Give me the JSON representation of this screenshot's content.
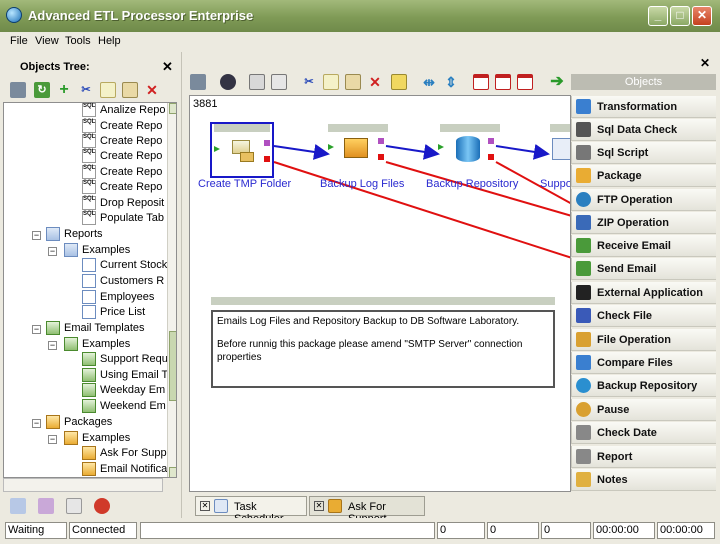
{
  "window": {
    "title": "Advanced ETL Processor Enterprise"
  },
  "menu": [
    "File",
    "View",
    "Tools",
    "Help"
  ],
  "objects_tree": {
    "title": "Objects Tree:",
    "nodes": [
      {
        "label": "Analize Repo",
        "icon": "sql-icon"
      },
      {
        "label": "Create Repo",
        "icon": "sql-icon"
      },
      {
        "label": "Create Repo",
        "icon": "sql-icon"
      },
      {
        "label": "Create Repo",
        "icon": "sql-icon"
      },
      {
        "label": "Create Repo",
        "icon": "sql-icon"
      },
      {
        "label": "Create Repo",
        "icon": "sql-icon"
      },
      {
        "label": "Drop Reposit",
        "icon": "sql-icon"
      },
      {
        "label": "Populate Tab",
        "icon": "sql-icon"
      },
      {
        "label": "Reports",
        "icon": "folder-icon"
      },
      {
        "label": "Examples",
        "icon": "folder-icon"
      },
      {
        "label": "Current Stock",
        "icon": "report-icon"
      },
      {
        "label": "Customers R",
        "icon": "report-icon"
      },
      {
        "label": "Employees",
        "icon": "report-icon"
      },
      {
        "label": "Price List",
        "icon": "report-icon"
      },
      {
        "label": "Email Templates",
        "icon": "mail-icon"
      },
      {
        "label": "Examples",
        "icon": "mail-icon"
      },
      {
        "label": "Support Requ",
        "icon": "mail-icon"
      },
      {
        "label": "Using Email T",
        "icon": "mail-icon"
      },
      {
        "label": "Weekday Em",
        "icon": "mail-icon"
      },
      {
        "label": "Weekend Em",
        "icon": "mail-icon"
      },
      {
        "label": "Packages",
        "icon": "package-icon"
      },
      {
        "label": "Examples",
        "icon": "package-icon"
      },
      {
        "label": "Ask For Supp",
        "icon": "package-icon"
      },
      {
        "label": "Email Notifica",
        "icon": "package-icon"
      }
    ]
  },
  "canvas": {
    "id": "3881",
    "nodes": [
      {
        "label": "Create TMP Folder"
      },
      {
        "label": "Backup Log Files"
      },
      {
        "label": "Backup Repository"
      },
      {
        "label": "Suppo"
      }
    ],
    "note": {
      "line1": "Emails Log Files and Repository Backup to DB Software Laboratory.",
      "line2": "Before runnig this package please amend \"SMTP Server\" connection properties"
    }
  },
  "palette": {
    "title": "Objects",
    "items": [
      {
        "label": "Transformation",
        "color": "#3a7fd0"
      },
      {
        "label": "Sql Data Check",
        "color": "#555555"
      },
      {
        "label": "Sql Script",
        "color": "#777777"
      },
      {
        "label": "Package",
        "color": "#e9ac33"
      },
      {
        "label": "FTP Operation",
        "color": "#2a7fc0"
      },
      {
        "label": "ZIP Operation",
        "color": "#3a6ab8"
      },
      {
        "label": "Receive Email",
        "color": "#4a9a3a"
      },
      {
        "label": "Send Email",
        "color": "#4a9a3a"
      },
      {
        "label": "External Application",
        "color": "#222222"
      },
      {
        "label": "Check File",
        "color": "#3a5ab8"
      },
      {
        "label": "File Operation",
        "color": "#d9a030"
      },
      {
        "label": "Compare Files",
        "color": "#3a7fd0"
      },
      {
        "label": "Backup Repository",
        "color": "#2a8fd0"
      },
      {
        "label": "Pause",
        "color": "#d9a030"
      },
      {
        "label": "Check Date",
        "color": "#888888"
      },
      {
        "label": "Report",
        "color": "#888888"
      },
      {
        "label": "Notes",
        "color": "#e0b040"
      }
    ]
  },
  "tabs": [
    {
      "label": "Task Scheduler"
    },
    {
      "label": "Ask For Support"
    }
  ],
  "status": {
    "state": "Waiting",
    "connection": "Connected",
    "count1": "0",
    "count2": "0",
    "count3": "0",
    "time1": "00:00:00",
    "time2": "00:00:00"
  }
}
